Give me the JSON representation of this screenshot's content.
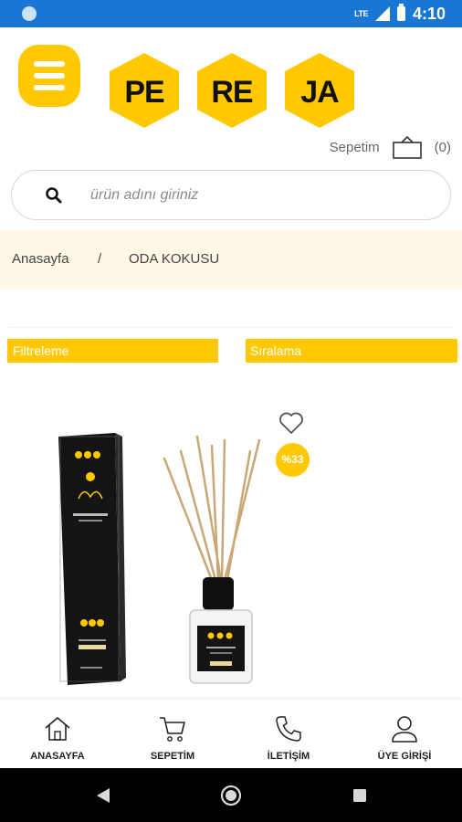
{
  "status_bar": {
    "network": "LTE",
    "time": "4:10"
  },
  "logo": {
    "parts": [
      "PE",
      "RE",
      "JA"
    ]
  },
  "cart": {
    "label": "Sepetim",
    "count": "(0)"
  },
  "search": {
    "placeholder": "ürün adını giriniz"
  },
  "breadcrumb": {
    "home": "Anasayfa",
    "separator": "/",
    "current": "ODA KOKUSU"
  },
  "filters": {
    "filter_label": "Filtreleme",
    "sort_label": "Sıralama"
  },
  "product": {
    "discount": "%33",
    "box_brand": "PE RE JA",
    "box_title": "Room Diffuser"
  },
  "bottom_nav": [
    {
      "label": "ANASAYFA",
      "icon": "home-icon"
    },
    {
      "label": "SEPETİM",
      "icon": "cart-icon"
    },
    {
      "label": "İLETİŞİM",
      "icon": "phone-icon"
    },
    {
      "label": "ÜYE GİRİŞİ",
      "icon": "user-icon"
    }
  ],
  "colors": {
    "brand": "#ffc800",
    "status_bar": "#1976d2",
    "breadcrumb_bg": "#fff8e6"
  }
}
